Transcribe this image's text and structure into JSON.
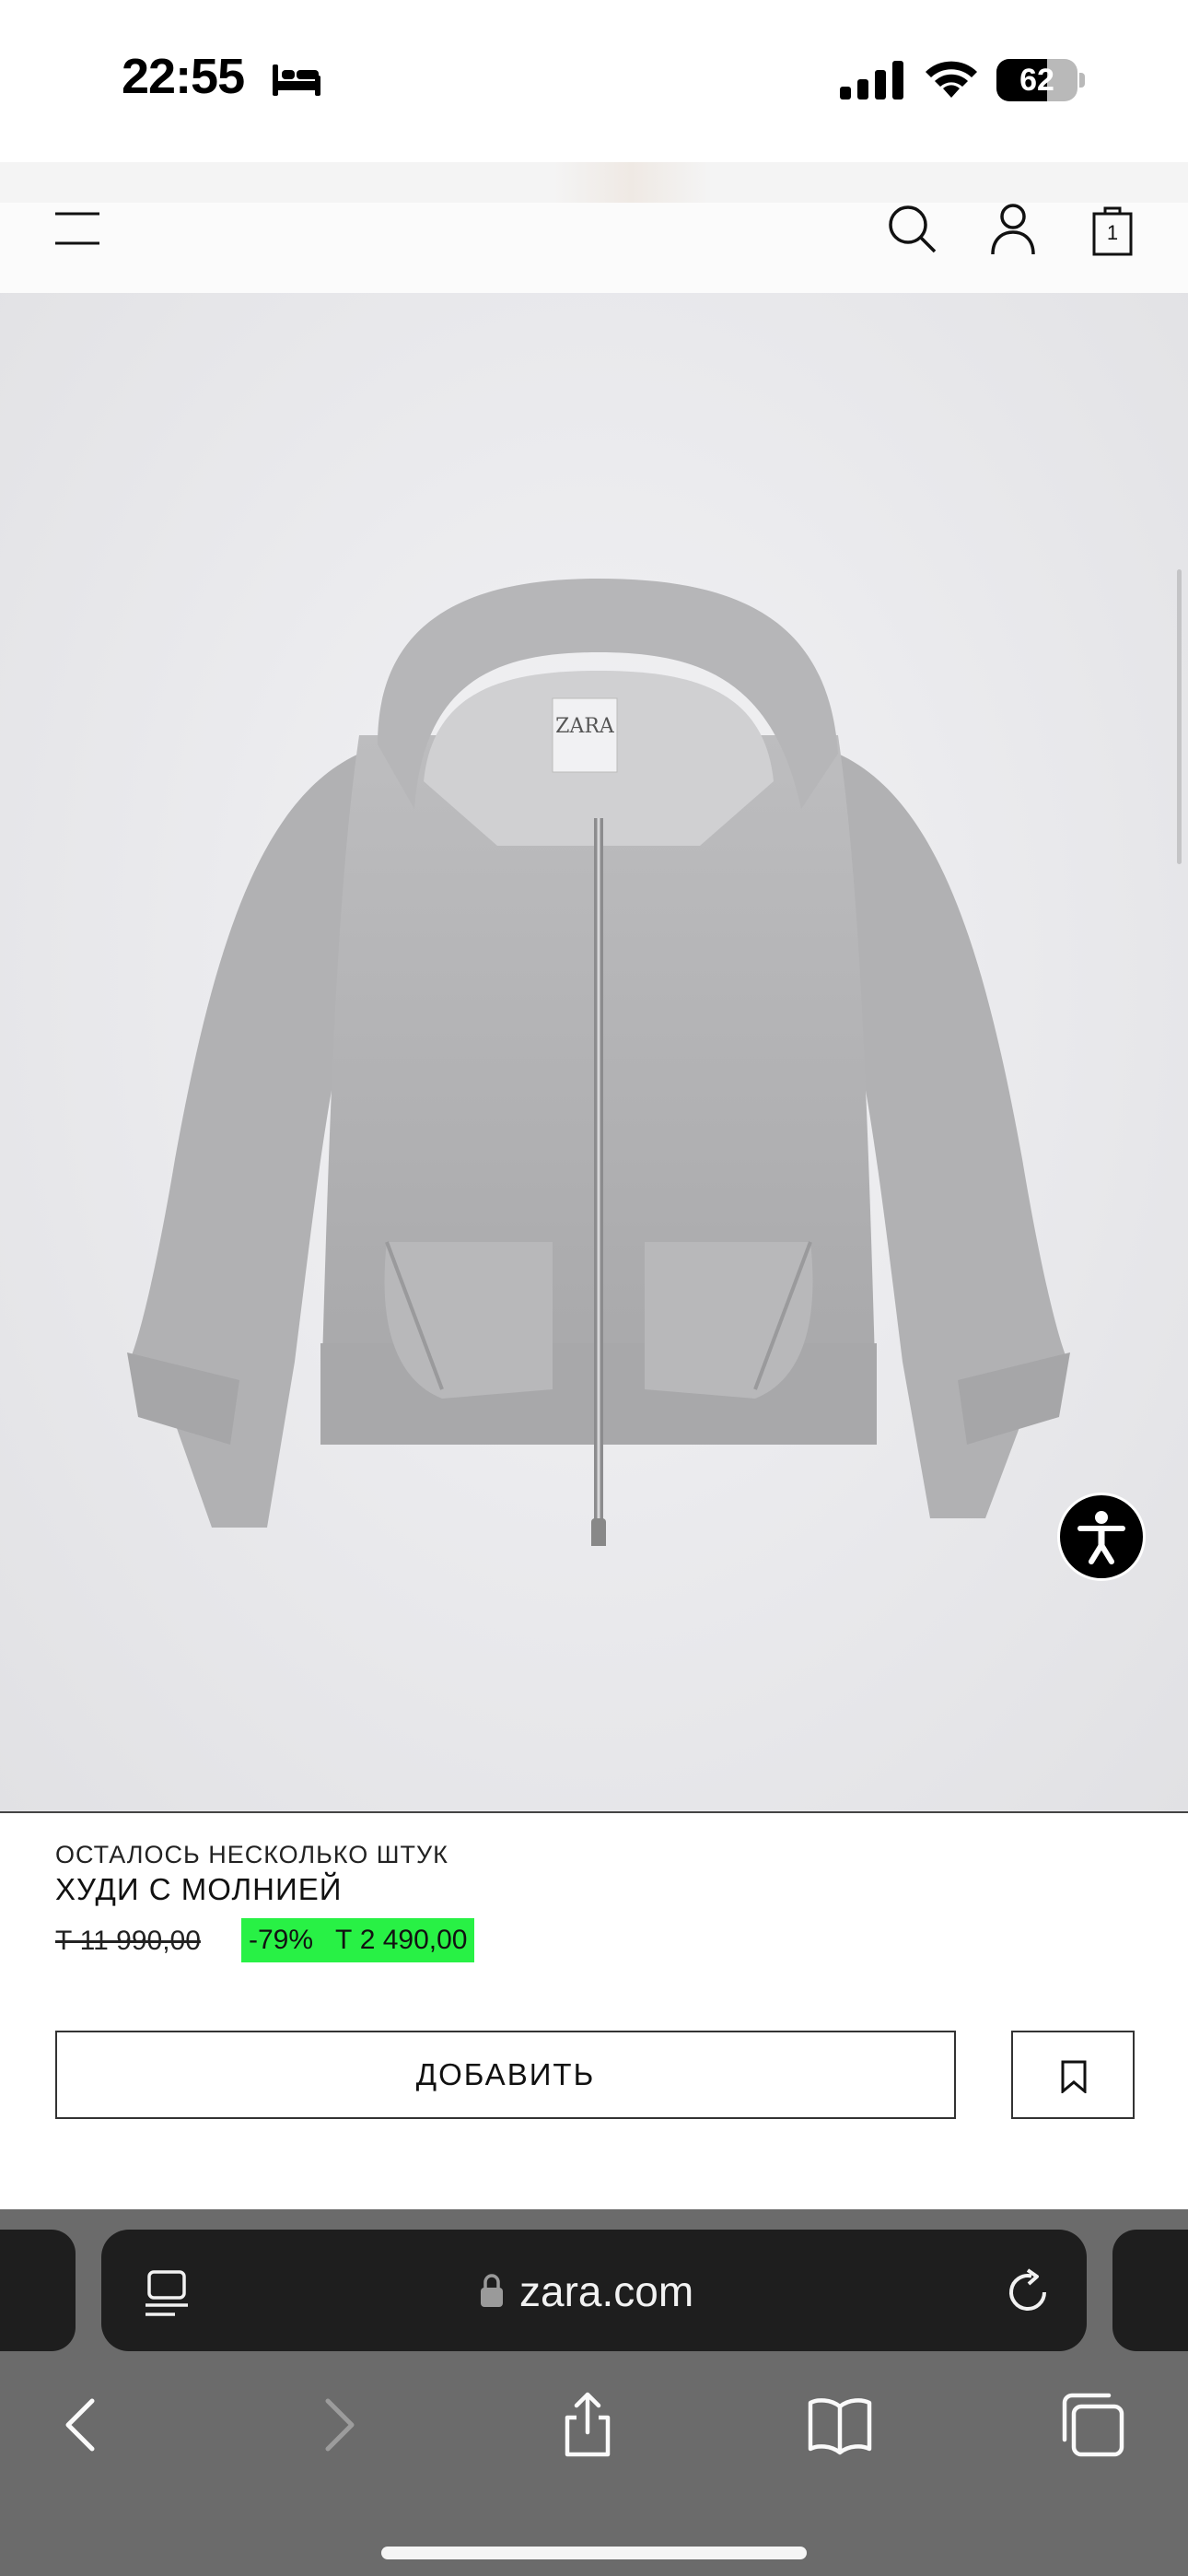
{
  "status_bar": {
    "time": "22:55",
    "focus_icon": "bed-icon",
    "battery_level": "62",
    "battery_fraction": 0.62
  },
  "header": {
    "icons": [
      "menu-icon",
      "search-icon",
      "account-icon",
      "shopping-bag-icon"
    ],
    "cart_count": "1"
  },
  "product": {
    "stock_note": "ОСТАЛОСЬ НЕСКОЛЬКО ШТУК",
    "name": "ХУДИ С МОЛНИЕЙ",
    "old_price": "Т 11 990,00",
    "discount": "-79%",
    "new_price": "Т 2 490,00",
    "sale_color": "#28f145",
    "image_brand": "ZARA"
  },
  "actions": {
    "add_label": "ДОБАВИТЬ",
    "bookmark_icon": "bookmark-icon"
  },
  "browser": {
    "url": "zara.com",
    "toolbar_icons": [
      "back-icon",
      "forward-icon",
      "share-icon",
      "bookmarks-icon",
      "tabs-icon"
    ]
  }
}
